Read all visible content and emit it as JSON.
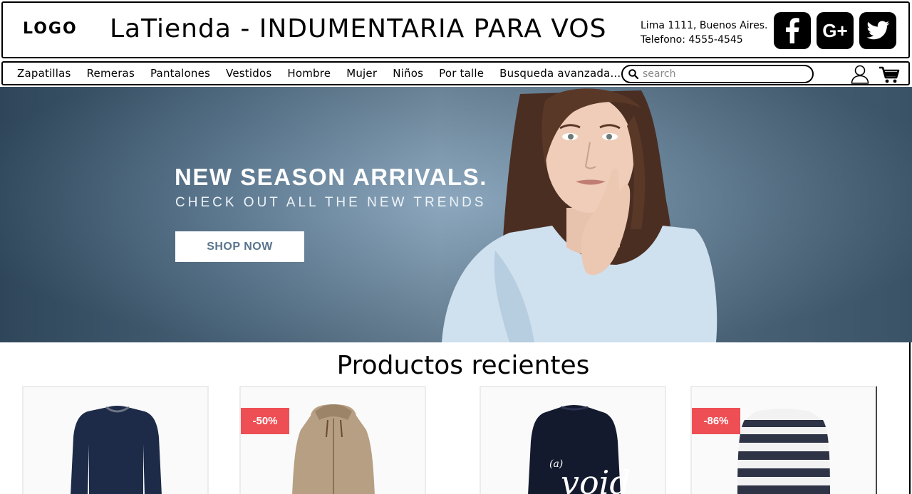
{
  "header": {
    "logo": "LOGO",
    "title": "LaTienda - INDUMENTARIA PARA VOS",
    "address": "Lima 1111, Buenos Aires.",
    "phone": "Telefono: 4555-4545",
    "social": [
      {
        "icon": "facebook-icon",
        "glyph": "f"
      },
      {
        "icon": "google-plus-icon",
        "glyph": "G+"
      },
      {
        "icon": "twitter-icon",
        "glyph": "twitter-bird"
      }
    ]
  },
  "nav": {
    "items": [
      {
        "label": "Zapatillas"
      },
      {
        "label": "Remeras"
      },
      {
        "label": "Pantalones"
      },
      {
        "label": "Vestidos"
      },
      {
        "label": "Hombre"
      },
      {
        "label": "Mujer"
      },
      {
        "label": "Niños"
      },
      {
        "label": "Por talle"
      },
      {
        "label": "Busqueda avanzada..."
      }
    ],
    "search": {
      "placeholder": "search",
      "value": ""
    },
    "icons": [
      "user-icon",
      "cart-icon"
    ]
  },
  "hero": {
    "title": "NEW SEASON ARRIVALS.",
    "subtitle": "CHECK OUT ALL THE NEW TRENDS",
    "button": "SHOP NOW"
  },
  "products": {
    "title": "Productos recientes",
    "items": [
      {
        "badge": "",
        "image": "navy sweater"
      },
      {
        "badge": "-50%",
        "image": "beige hooded jacket"
      },
      {
        "badge": "",
        "image": "navy graphic sweatshirt"
      },
      {
        "badge": "-86%",
        "image": "striped sweater"
      }
    ]
  },
  "colors": {
    "badge": "#ee4f55",
    "hero_blue": "#5d7f9b",
    "button_text": "#5a748c"
  }
}
